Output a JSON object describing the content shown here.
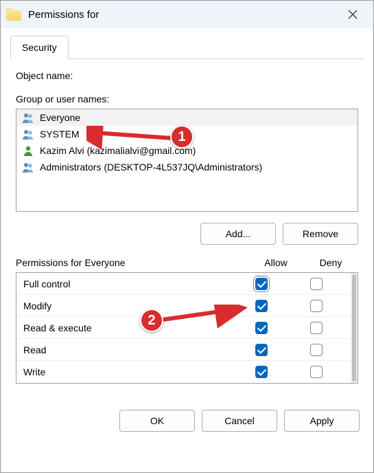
{
  "window": {
    "title": "Permissions for"
  },
  "tabs": {
    "security": "Security"
  },
  "labels": {
    "objectName": "Object name:",
    "groupOrUserNames": "Group or user names:",
    "add": "Add...",
    "remove": "Remove",
    "permissionsFor": "Permissions for Everyone",
    "allow": "Allow",
    "deny": "Deny",
    "ok": "OK",
    "cancel": "Cancel",
    "apply": "Apply"
  },
  "principals": [
    {
      "name": "Everyone",
      "icon": "group",
      "selected": true
    },
    {
      "name": "SYSTEM",
      "icon": "group",
      "selected": false
    },
    {
      "name": "Kazim Alvi (kazimalialvi@gmail.com)",
      "icon": "user",
      "selected": false
    },
    {
      "name": "Administrators (DESKTOP-4L537JQ\\Administrators)",
      "icon": "group",
      "selected": false
    }
  ],
  "permissions": [
    {
      "name": "Full control",
      "allow": true,
      "deny": false,
      "focus": true
    },
    {
      "name": "Modify",
      "allow": true,
      "deny": false
    },
    {
      "name": "Read & execute",
      "allow": true,
      "deny": false
    },
    {
      "name": "Read",
      "allow": true,
      "deny": false
    },
    {
      "name": "Write",
      "allow": true,
      "deny": false
    }
  ],
  "annotations": {
    "b1": "1",
    "b2": "2"
  }
}
